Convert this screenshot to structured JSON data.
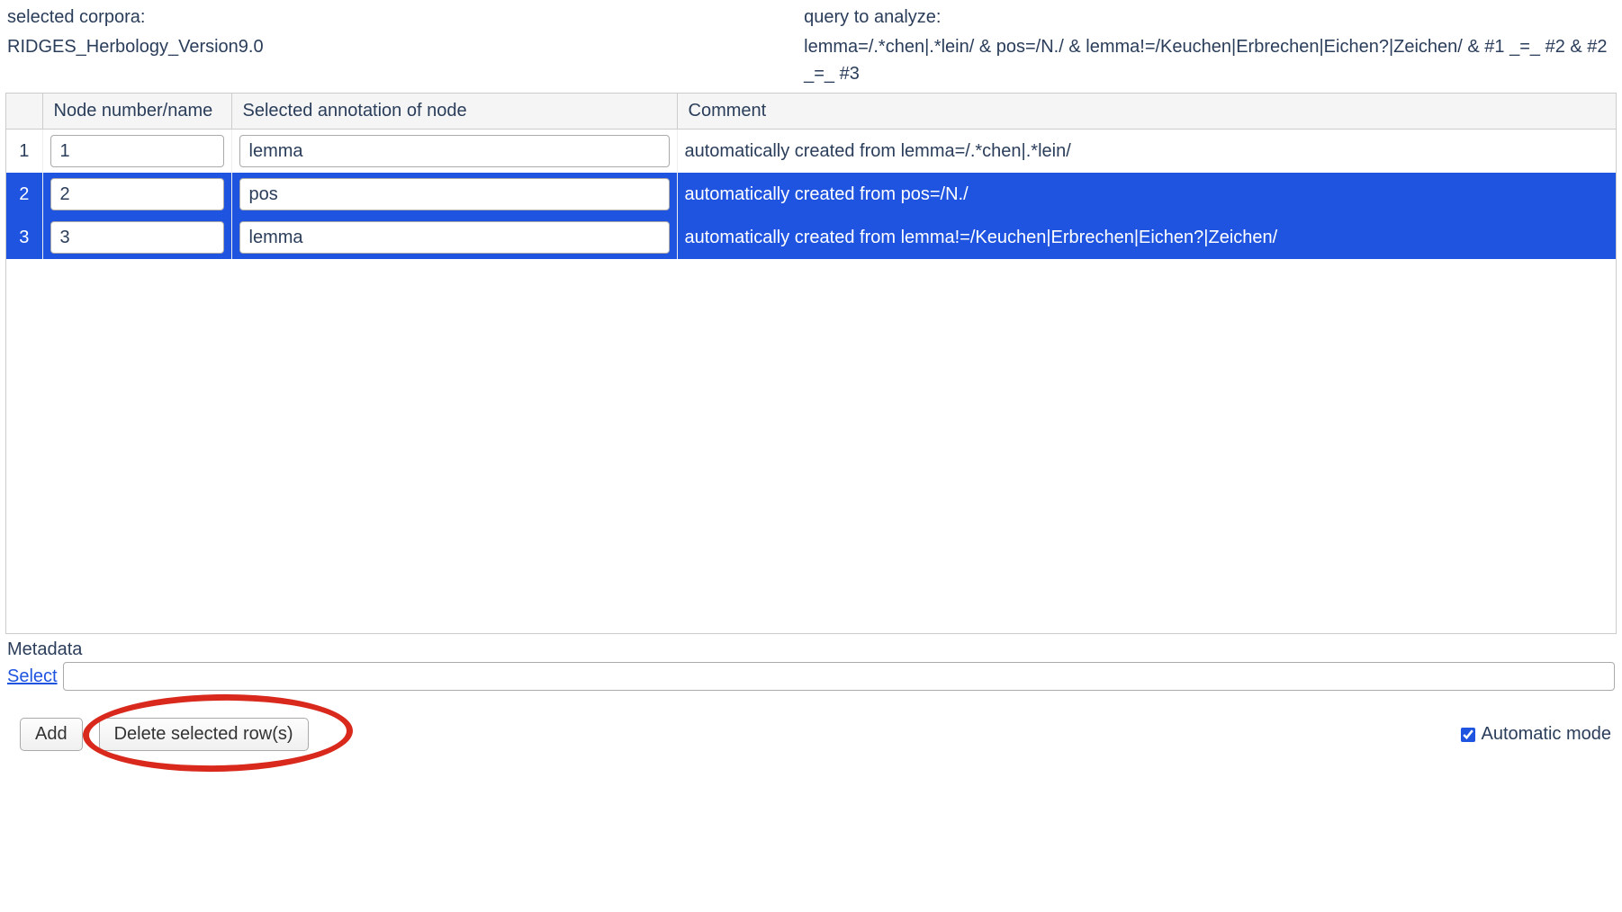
{
  "header": {
    "corpora_label": "selected corpora:",
    "corpora_value": "RIDGES_Herbology_Version9.0",
    "query_label": "query to analyze:",
    "query_value": "lemma=/.*chen|.*lein/ & pos=/N./ & lemma!=/Keuchen|Erbrechen|Eichen?|Zeichen/ & #1 _=_ #2 & #2 _=_ #3"
  },
  "table": {
    "columns": {
      "node": "Node number/name",
      "annotation": "Selected annotation of node",
      "comment": "Comment"
    },
    "rows": [
      {
        "num": "1",
        "node": "1",
        "annotation": "lemma",
        "comment": "automatically created from lemma=/.*chen|.*lein/",
        "selected": false
      },
      {
        "num": "2",
        "node": "2",
        "annotation": "pos",
        "comment": "automatically created from pos=/N./",
        "selected": true
      },
      {
        "num": "3",
        "node": "3",
        "annotation": "lemma",
        "comment": "automatically created from lemma!=/Keuchen|Erbrechen|Eichen?|Zeichen/",
        "selected": true
      }
    ]
  },
  "metadata": {
    "label": "Metadata",
    "select_link": "Select",
    "input_value": ""
  },
  "footer": {
    "add_label": "Add",
    "delete_label": "Delete selected row(s)",
    "auto_mode_label": "Automatic mode",
    "auto_mode_checked": true
  }
}
